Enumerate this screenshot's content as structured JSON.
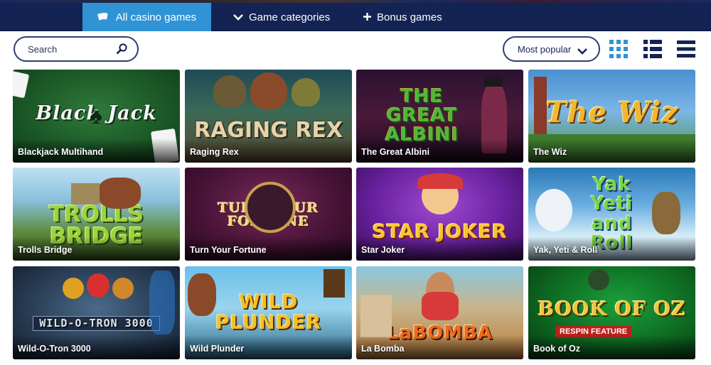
{
  "nav": {
    "tabs": [
      {
        "label": "All casino games",
        "icon": "cards-icon"
      },
      {
        "label": "Game categories",
        "icon": "chevron-down-icon"
      },
      {
        "label": "Bonus games",
        "icon": "plus-icon"
      }
    ]
  },
  "search": {
    "placeholder": "Search"
  },
  "sort": {
    "label": "Most popular"
  },
  "colors": {
    "nav_bg": "#132354",
    "active_tab": "#2f93d6",
    "outline": "#2a3f6e"
  },
  "games": [
    {
      "name": "Blackjack Multihand",
      "logo": "Black Jack"
    },
    {
      "name": "Raging Rex",
      "logo": "RAGING REX"
    },
    {
      "name": "The Great Albini",
      "logo": "THE GREAT ALBINI"
    },
    {
      "name": "The Wiz",
      "logo": "The Wiz"
    },
    {
      "name": "Trolls Bridge",
      "logo": "TROLLS BRIDGE"
    },
    {
      "name": "Turn Your Fortune",
      "logo": "TURN YOUR FORTUNE"
    },
    {
      "name": "Star Joker",
      "logo": "STAR JOKER"
    },
    {
      "name": "Yak, Yeti & Roll",
      "logo": "Yak Yeti and Roll"
    },
    {
      "name": "Wild-O-Tron 3000",
      "logo": "WILD-O-TRON 3000"
    },
    {
      "name": "Wild Plunder",
      "logo": "WILD PLUNDER"
    },
    {
      "name": "La Bomba",
      "logo": "LaBOMBA"
    },
    {
      "name": "Book of Oz",
      "logo": "BOOK OF OZ"
    }
  ],
  "game_badges": {
    "book_of_oz": "RESPIN FEATURE"
  }
}
